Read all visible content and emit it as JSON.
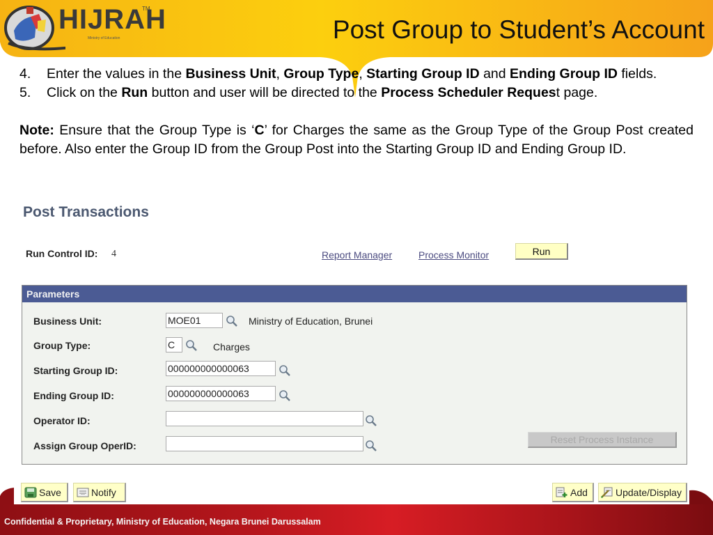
{
  "header": {
    "logo_text": "HIJRAH",
    "logo_tm": "TM",
    "logo_subtitle": "Ministry of Education",
    "slide_title": "Post Group to Student’s Account",
    "brand_color": "#f9c10e"
  },
  "instructions": {
    "step4": {
      "number": "4.",
      "t1": "Enter the values in the ",
      "b1": "Business Unit",
      "t2": ", ",
      "b2": "Group Type",
      "t3": ", ",
      "b3": "Starting Group ID",
      "t4": " and ",
      "b4": "Ending Group ID",
      "t5": " fields."
    },
    "step5": {
      "number": "5.",
      "t1": "Click on the ",
      "b1": "Run",
      "t2": " button and user will be directed to the ",
      "b2": "Process Scheduler Reques",
      "t3": "t page."
    },
    "note": {
      "label": "Note:",
      "t1": " Ensure that the Group Type is ‘",
      "b1": "C",
      "t2": "’ for Charges the same as the Group Type of the Group Post created before. Also enter the Group ID from the Group Post into the Starting Group ID and Ending Group ID."
    }
  },
  "page": {
    "title": "Post Transactions",
    "run_control_label": "Run Control ID:",
    "run_control_value": "4",
    "links": {
      "report_manager": "Report Manager",
      "process_monitor": "Process Monitor"
    },
    "run_button": "Run",
    "parameters": {
      "header": "Parameters",
      "business_unit": {
        "label": "Business Unit:",
        "value": "MOE01",
        "description": "Ministry of Education, Brunei"
      },
      "group_type": {
        "label": "Group Type:",
        "value": "C",
        "description": "Charges"
      },
      "starting_group_id": {
        "label": "Starting Group ID:",
        "value": "000000000000063"
      },
      "ending_group_id": {
        "label": "Ending Group ID:",
        "value": "000000000000063"
      },
      "operator_id": {
        "label": "Operator ID:",
        "value": ""
      },
      "assign_group_operid": {
        "label": "Assign Group OperID:",
        "value": ""
      },
      "reset_button": "Reset Process Instance"
    },
    "toolbar": {
      "save": "Save",
      "notify": "Notify",
      "add": "Add",
      "update_display": "Update/Display"
    }
  },
  "footer": {
    "text": "Confidential & Proprietary, Ministry of Education, Negara Brunei Darussalam",
    "color": "#b5161c"
  }
}
